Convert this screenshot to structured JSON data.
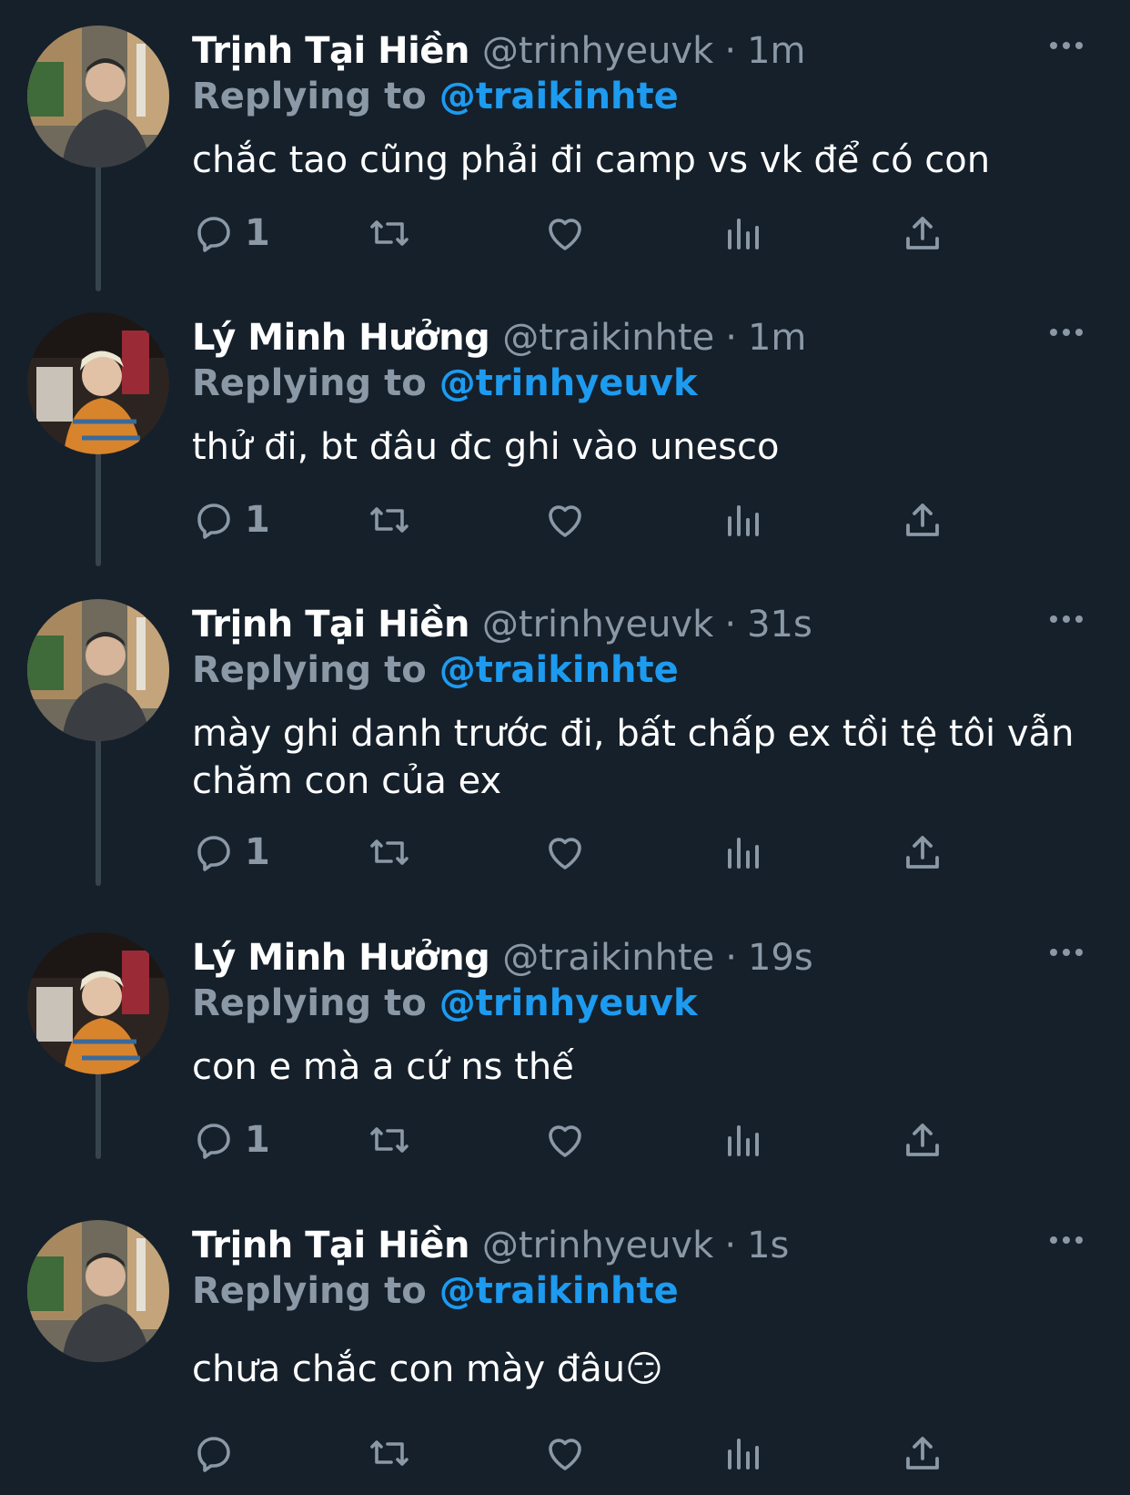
{
  "colors": {
    "background": "#15202b",
    "muted": "#8b98a5",
    "accent": "#1d9bf0",
    "thread_line": "#38444d"
  },
  "icons": {
    "reply": "reply-icon",
    "retweet": "retweet-icon",
    "like": "heart-icon",
    "views": "analytics-icon",
    "share": "share-icon",
    "more": "more-icon"
  },
  "tweets": [
    {
      "name": "Trịnh Tại Hiền",
      "handle": "@trinhyeuvk",
      "separator": "·",
      "time": "1m",
      "replying_label": "Replying to",
      "replying_to": "@traikinhte",
      "text": "chắc tao cũng phải đi camp vs vk để có con",
      "reply_count": "1"
    },
    {
      "name": "Lý Minh Hưởng",
      "handle": "@traikinhte",
      "separator": "·",
      "time": "1m",
      "replying_label": "Replying to",
      "replying_to": "@trinhyeuvk",
      "text": "thử đi, bt đâu đc ghi vào unesco",
      "reply_count": "1"
    },
    {
      "name": "Trịnh Tại Hiền",
      "handle": "@trinhyeuvk",
      "separator": "·",
      "time": "31s",
      "replying_label": "Replying to",
      "replying_to": "@traikinhte",
      "text": "mày ghi danh trước đi, bất chấp ex tồi tệ tôi vẫn\nchăm con của ex",
      "reply_count": "1"
    },
    {
      "name": "Lý Minh Hưởng",
      "handle": "@traikinhte",
      "separator": "·",
      "time": "19s",
      "replying_label": "Replying to",
      "replying_to": "@trinhyeuvk",
      "text": "con e mà a cứ ns thế",
      "reply_count": "1"
    },
    {
      "name": "Trịnh Tại Hiền",
      "handle": "@trinhyeuvk",
      "separator": "·",
      "time": "1s",
      "replying_label": "Replying to",
      "replying_to": "@traikinhte",
      "text": "chưa chắc con mày đâu😏",
      "reply_count": ""
    }
  ]
}
